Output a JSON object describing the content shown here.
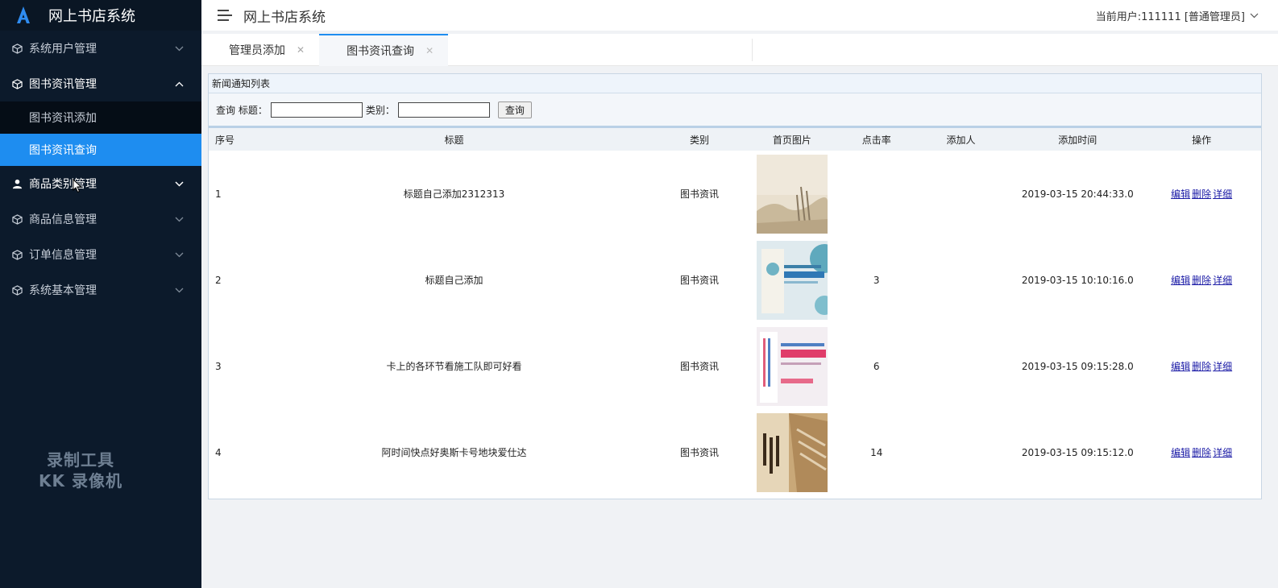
{
  "app": {
    "brand_title": "网上书店系统",
    "header_title": "网上书店系统",
    "user_info": "当前用户:111111 [普通管理员]"
  },
  "sidebar": {
    "items": [
      {
        "label": "系统用户管理",
        "icon": "cube-icon",
        "expanded": false
      },
      {
        "label": "图书资讯管理",
        "icon": "cube-icon",
        "expanded": true,
        "children": [
          {
            "label": "图书资讯添加",
            "active": false
          },
          {
            "label": "图书资讯查询",
            "active": true
          }
        ]
      },
      {
        "label": "商品类别管理",
        "icon": "user-icon",
        "expanded": false
      },
      {
        "label": "商品信息管理",
        "icon": "cube-icon",
        "expanded": false
      },
      {
        "label": "订单信息管理",
        "icon": "cube-icon",
        "expanded": false
      },
      {
        "label": "系统基本管理",
        "icon": "cube-icon",
        "expanded": false
      }
    ],
    "watermark_line1": "录制工具",
    "watermark_line2": "KK 录像机"
  },
  "tabs": [
    {
      "label": "管理员添加",
      "active": false
    },
    {
      "label": "图书资讯查询",
      "active": true
    }
  ],
  "panel": {
    "title": "新闻通知列表",
    "search": {
      "prefix": "查询 标题：",
      "category_label": "类别：",
      "title_value": "",
      "category_value": "",
      "button_label": "查询"
    },
    "columns": [
      "序号",
      "标题",
      "类别",
      "首页图片",
      "点击率",
      "添加人",
      "添加时间",
      "操作"
    ],
    "rows": [
      {
        "no": "1",
        "title": "标题自己添加2312313",
        "category": "图书资讯",
        "clicks": "",
        "adder": "",
        "time": "2019-03-15 20:44:33.0"
      },
      {
        "no": "2",
        "title": "标题自己添加",
        "category": "图书资讯",
        "clicks": "3",
        "adder": "",
        "time": "2019-03-15 10:10:16.0"
      },
      {
        "no": "3",
        "title": "卡上的各环节看施工队即可好看",
        "category": "图书资讯",
        "clicks": "6",
        "adder": "",
        "time": "2019-03-15 09:15:28.0"
      },
      {
        "no": "4",
        "title": "阿时间快点好奥斯卡号地块爱仕达",
        "category": "图书资讯",
        "clicks": "14",
        "adder": "",
        "time": "2019-03-15 09:15:12.0"
      }
    ],
    "actions": {
      "edit": "编辑",
      "delete": "删除",
      "detail": "详细"
    }
  },
  "colors": {
    "sidebar_bg": "#0c1a2b",
    "active_accent": "#1e8df0",
    "link": "#1a1aa6"
  }
}
